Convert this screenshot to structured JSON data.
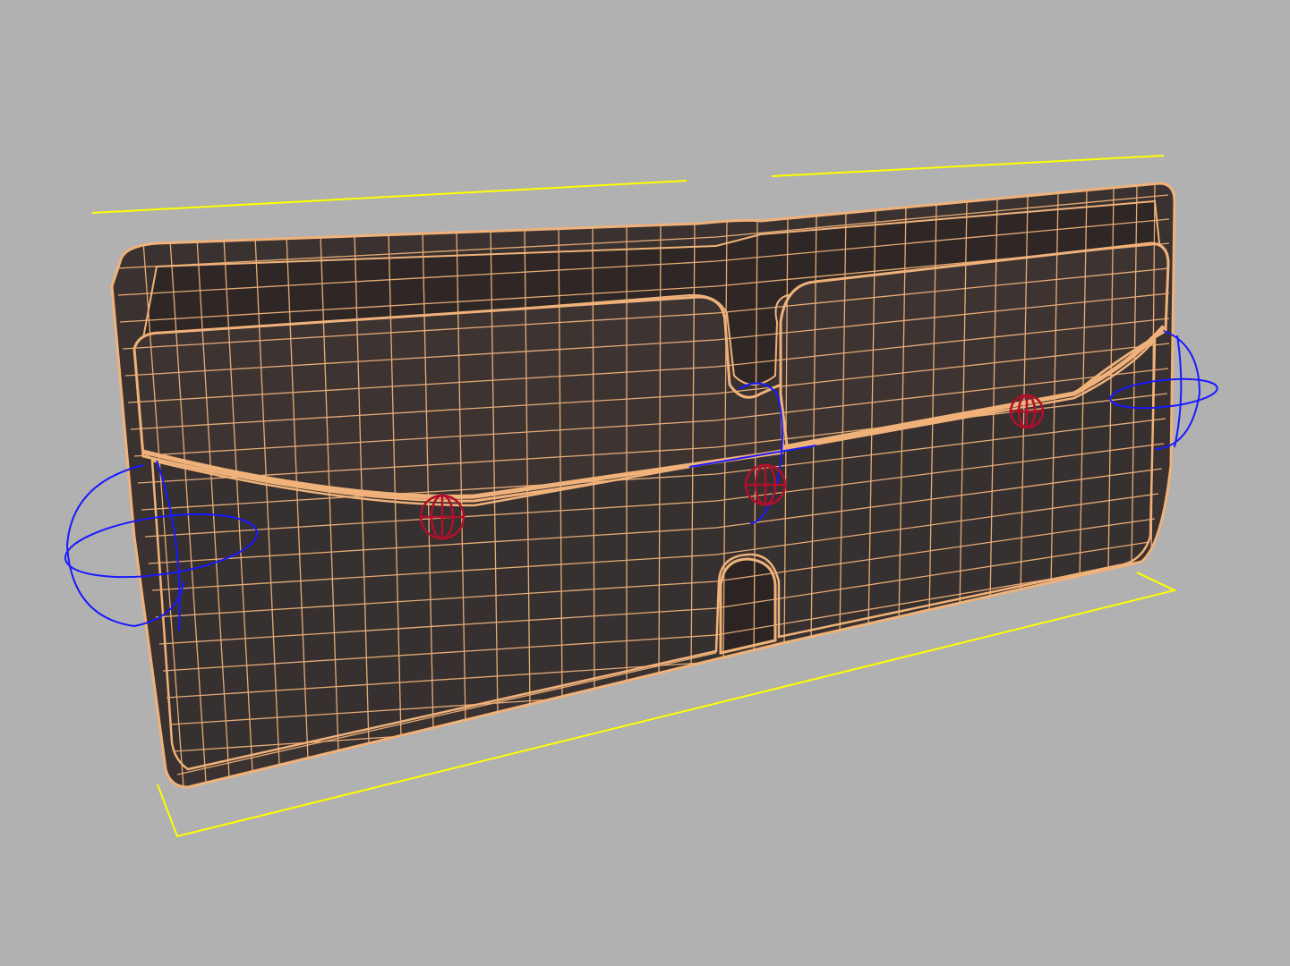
{
  "viewport": {
    "background_color": "#b1b1b1",
    "selection_bracket_color": "#ffff00",
    "wireframe_color": "#f0b27a",
    "mesh_fill_color": "#3a3230",
    "bone_ring_color": "#1a1aff",
    "control_point_color": "#b0102a"
  },
  "model": {
    "name": "wallet-mesh",
    "embossed_text_lines": [
      "",
      "",
      ""
    ]
  }
}
